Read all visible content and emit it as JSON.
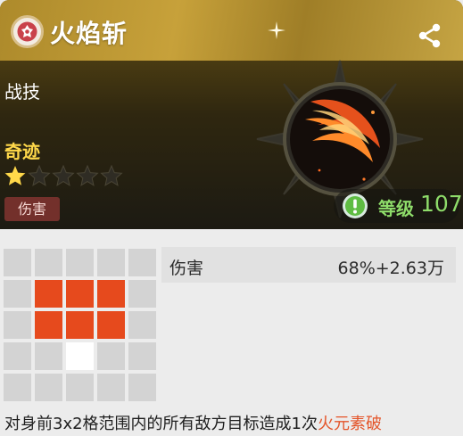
{
  "skill": {
    "title": "火焰斩",
    "category": "战技",
    "rarity_label": "奇迹",
    "stars": {
      "filled": 1,
      "total": 5
    },
    "tag": "伤害",
    "level_label": "等级",
    "level_value": "107",
    "icons": {
      "header": "element-badge-icon",
      "share": "share-icon",
      "warning": "exclamation-icon",
      "emblem": "fire-slash-emblem"
    }
  },
  "stat": {
    "label": "伤害",
    "value": "68%+2.63万"
  },
  "range_grid": {
    "rows": 5,
    "cols": 5,
    "cells": [
      [
        "empty",
        "empty",
        "empty",
        "empty",
        "empty"
      ],
      [
        "empty",
        "hit",
        "hit",
        "hit",
        "empty"
      ],
      [
        "empty",
        "hit",
        "hit",
        "hit",
        "empty"
      ],
      [
        "empty",
        "empty",
        "self",
        "empty",
        "empty"
      ],
      [
        "empty",
        "empty",
        "empty",
        "empty",
        "empty"
      ]
    ]
  },
  "description": {
    "text": "对身前3x2格范围内的所有敌方目标造成1次",
    "highlight": "火元素破"
  },
  "colors": {
    "hit": "#e64a1d",
    "self": "#ffffff",
    "empty": "#d3d3d3",
    "level": "#8edc6a",
    "rarity": "#ffd84a",
    "highlight": "#e4552a"
  }
}
